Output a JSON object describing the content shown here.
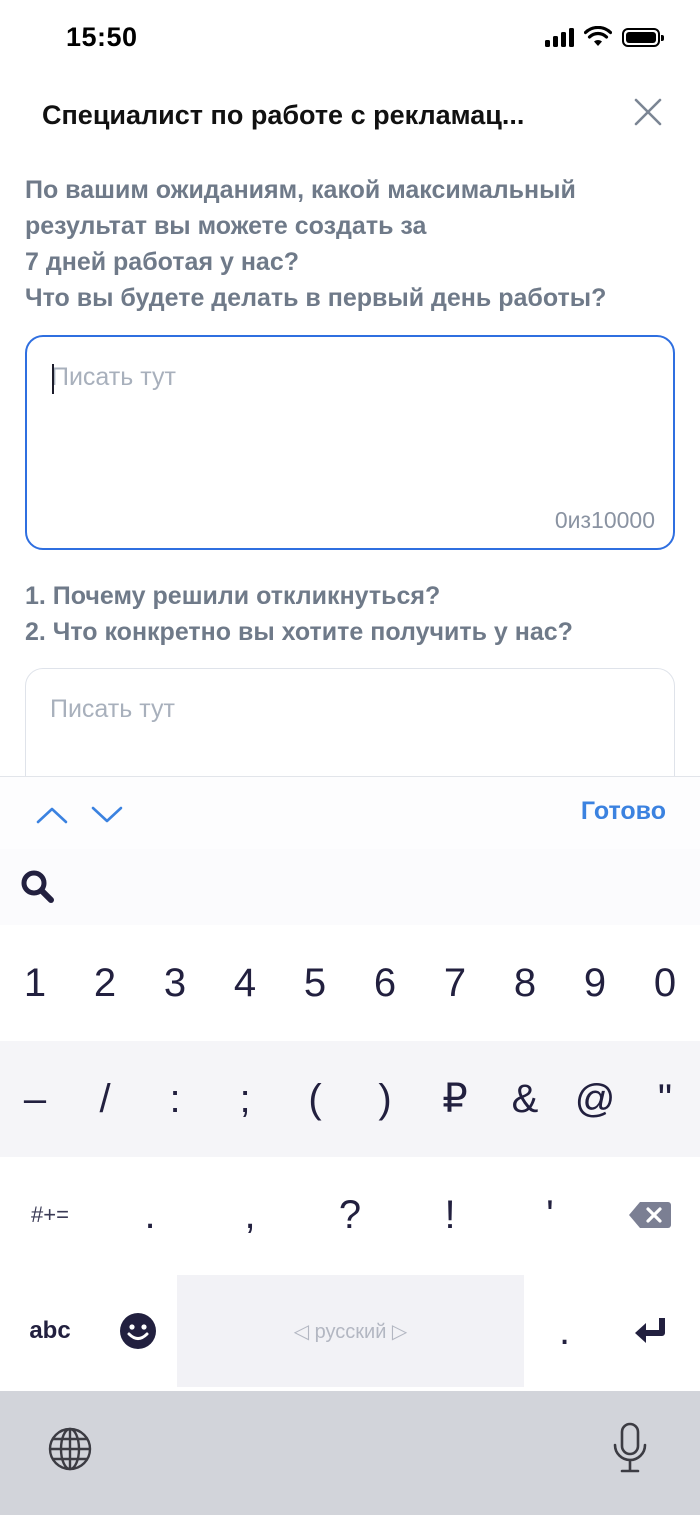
{
  "status_bar": {
    "time": "15:50"
  },
  "header": {
    "title": "Специалист по работе с рекламац..."
  },
  "question_1": {
    "lines": [
      "По вашим ожиданиям, какой максимальный",
      "результат вы можете создать за",
      "7 дней работая у нас?",
      "Что вы будете делать в первый день работы?"
    ]
  },
  "answer_1": {
    "placeholder": "Писать тут",
    "counter": "0из10000"
  },
  "question_2": {
    "lines": [
      "1. Почему решили откликнуться?",
      "2. Что конкретно вы хотите получить у нас?"
    ]
  },
  "answer_2": {
    "placeholder": "Писать тут"
  },
  "keyboard": {
    "done_label": "Готово",
    "digits": [
      "1",
      "2",
      "3",
      "4",
      "5",
      "6",
      "7",
      "8",
      "9",
      "0"
    ],
    "symbols": [
      "–",
      "/",
      ":",
      ";",
      "(",
      ")",
      "₽",
      "&",
      "@",
      "\""
    ],
    "punct": [
      "#+=",
      ".",
      ",",
      "?",
      "!",
      "'"
    ],
    "abc_label": "abc",
    "space_label": "◁ русский ▷",
    "dot_label": "."
  }
}
